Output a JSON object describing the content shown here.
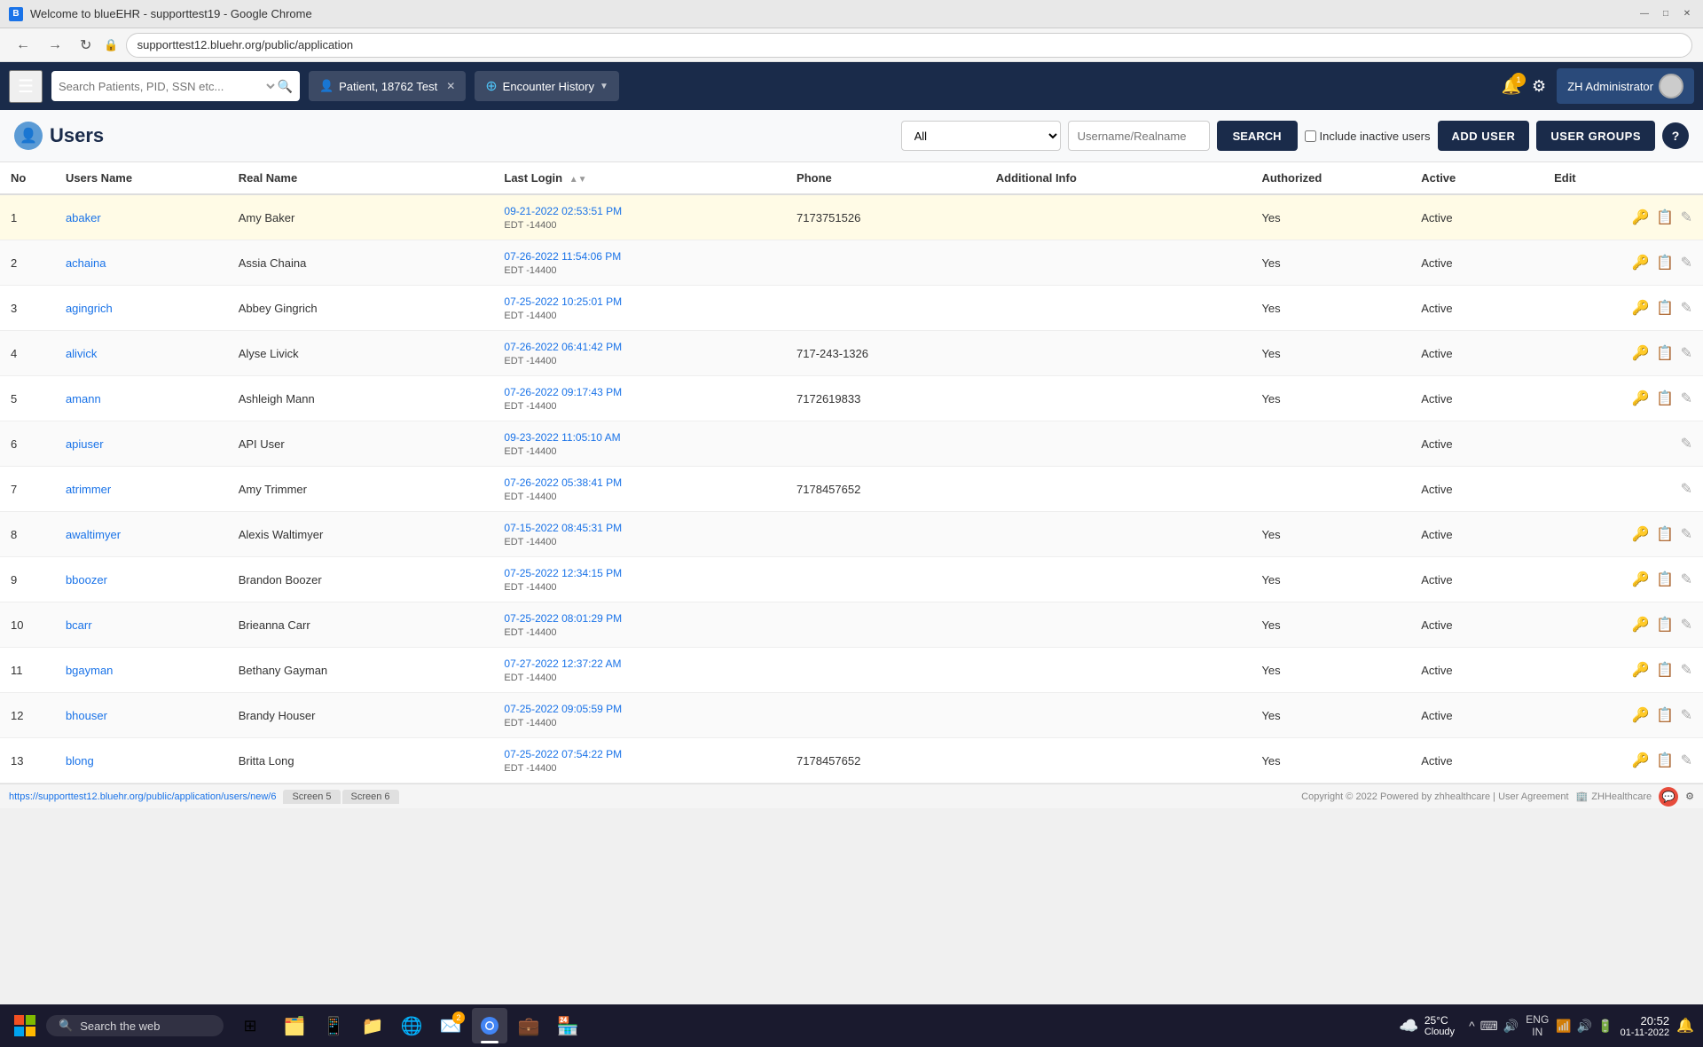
{
  "browser": {
    "title": "Welcome to blueEHR - supporttest19 - Google Chrome",
    "url": "supporttest12.bluehr.org/public/application",
    "favicon": "B"
  },
  "header": {
    "search_placeholder": "Search Patients, PID, SSN etc...",
    "tabs": [
      {
        "label": "Patient, 18762 Test",
        "icon": "👤",
        "closable": true
      },
      {
        "label": "Encounter History",
        "icon": "⊕",
        "closable": false,
        "dropdown": true
      }
    ],
    "notifications_count": "1",
    "user_label": "ZH Administrator"
  },
  "users_page": {
    "title": "Users",
    "filter_options": [
      "All"
    ],
    "filter_selected": "All",
    "username_placeholder": "Username/Realname",
    "search_btn": "SEARCH",
    "include_inactive_label": "Include inactive users",
    "add_user_btn": "ADD USER",
    "user_groups_btn": "USER GROUPS"
  },
  "table": {
    "columns": [
      "No",
      "Users Name",
      "Real Name",
      "Last Login",
      "Phone",
      "Additional Info",
      "Authorized",
      "Active",
      "Edit"
    ],
    "rows": [
      {
        "no": 1,
        "username": "abaker",
        "realname": "Amy Baker",
        "last_login": "09-21-2022 02:53:51 PM",
        "tz": "EDT -14400",
        "phone": "7173751526",
        "additional": "",
        "authorized": "Yes",
        "active": "Active",
        "highlighted": true
      },
      {
        "no": 2,
        "username": "achaina",
        "realname": "Assia Chaina",
        "last_login": "07-26-2022 11:54:06 PM",
        "tz": "EDT -14400",
        "phone": "",
        "additional": "",
        "authorized": "Yes",
        "active": "Active",
        "highlighted": false
      },
      {
        "no": 3,
        "username": "agingrich",
        "realname": "Abbey Gingrich",
        "last_login": "07-25-2022 10:25:01 PM",
        "tz": "EDT -14400",
        "phone": "",
        "additional": "",
        "authorized": "Yes",
        "active": "Active",
        "highlighted": false
      },
      {
        "no": 4,
        "username": "alivick",
        "realname": "Alyse Livick",
        "last_login": "07-26-2022 06:41:42 PM",
        "tz": "EDT -14400",
        "phone": "717-243-1326",
        "additional": "",
        "authorized": "Yes",
        "active": "Active",
        "highlighted": false
      },
      {
        "no": 5,
        "username": "amann",
        "realname": "Ashleigh Mann",
        "last_login": "07-26-2022 09:17:43 PM",
        "tz": "EDT -14400",
        "phone": "7172619833",
        "additional": "",
        "authorized": "Yes",
        "active": "Active",
        "highlighted": false
      },
      {
        "no": 6,
        "username": "apiuser",
        "realname": "API User",
        "last_login": "09-23-2022 11:05:10 AM",
        "tz": "EDT -14400",
        "phone": "",
        "additional": "",
        "authorized": "",
        "active": "Active",
        "highlighted": false
      },
      {
        "no": 7,
        "username": "atrimmer",
        "realname": "Amy Trimmer",
        "last_login": "07-26-2022 05:38:41 PM",
        "tz": "EDT -14400",
        "phone": "7178457652",
        "additional": "",
        "authorized": "",
        "active": "Active",
        "highlighted": false
      },
      {
        "no": 8,
        "username": "awaltimyer",
        "realname": "Alexis Waltimyer",
        "last_login": "07-15-2022 08:45:31 PM",
        "tz": "EDT -14400",
        "phone": "",
        "additional": "",
        "authorized": "Yes",
        "active": "Active",
        "highlighted": false
      },
      {
        "no": 9,
        "username": "bboozer",
        "realname": "Brandon Boozer",
        "last_login": "07-25-2022 12:34:15 PM",
        "tz": "EDT -14400",
        "phone": "",
        "additional": "",
        "authorized": "Yes",
        "active": "Active",
        "highlighted": false
      },
      {
        "no": 10,
        "username": "bcarr",
        "realname": "Brieanna Carr",
        "last_login": "07-25-2022 08:01:29 PM",
        "tz": "EDT -14400",
        "phone": "",
        "additional": "",
        "authorized": "Yes",
        "active": "Active",
        "highlighted": false
      },
      {
        "no": 11,
        "username": "bgayman",
        "realname": "Bethany Gayman",
        "last_login": "07-27-2022 12:37:22 AM",
        "tz": "EDT -14400",
        "phone": "",
        "additional": "",
        "authorized": "Yes",
        "active": "Active",
        "highlighted": false
      },
      {
        "no": 12,
        "username": "bhouser",
        "realname": "Brandy Houser",
        "last_login": "07-25-2022 09:05:59 PM",
        "tz": "EDT -14400",
        "phone": "",
        "additional": "",
        "authorized": "Yes",
        "active": "Active",
        "highlighted": false
      },
      {
        "no": 13,
        "username": "blong",
        "realname": "Britta Long",
        "last_login": "07-25-2022 07:54:22 PM",
        "tz": "EDT -14400",
        "phone": "7178457652",
        "additional": "",
        "authorized": "Yes",
        "active": "Active",
        "highlighted": false
      }
    ]
  },
  "status_bar": {
    "url": "https://supporttest12.bluehr.org/public/application/users/new/6",
    "screens": [
      "Screen 5",
      "Screen 6"
    ],
    "copyright": "Copyright © 2022 Powered by zhhealthcare | User Agreement"
  },
  "taskbar": {
    "search_label": "Search the web",
    "weather": "25°C",
    "weather_desc": "Cloudy",
    "time": "20:52",
    "date": "01-11-2022",
    "lang": "ENG\nIN",
    "apps": [
      {
        "name": "file-explorer",
        "icon": "📁",
        "active": false
      },
      {
        "name": "teams",
        "icon": "📱",
        "active": false
      },
      {
        "name": "folder",
        "icon": "🗂️",
        "active": false
      },
      {
        "name": "edge",
        "icon": "🌐",
        "active": false
      },
      {
        "name": "mail",
        "icon": "✉️",
        "active": false,
        "badge": "2"
      },
      {
        "name": "chrome",
        "icon": "🔵",
        "active": true
      },
      {
        "name": "teams2",
        "icon": "💼",
        "active": false
      },
      {
        "name": "store",
        "icon": "🔮",
        "active": false
      }
    ]
  }
}
